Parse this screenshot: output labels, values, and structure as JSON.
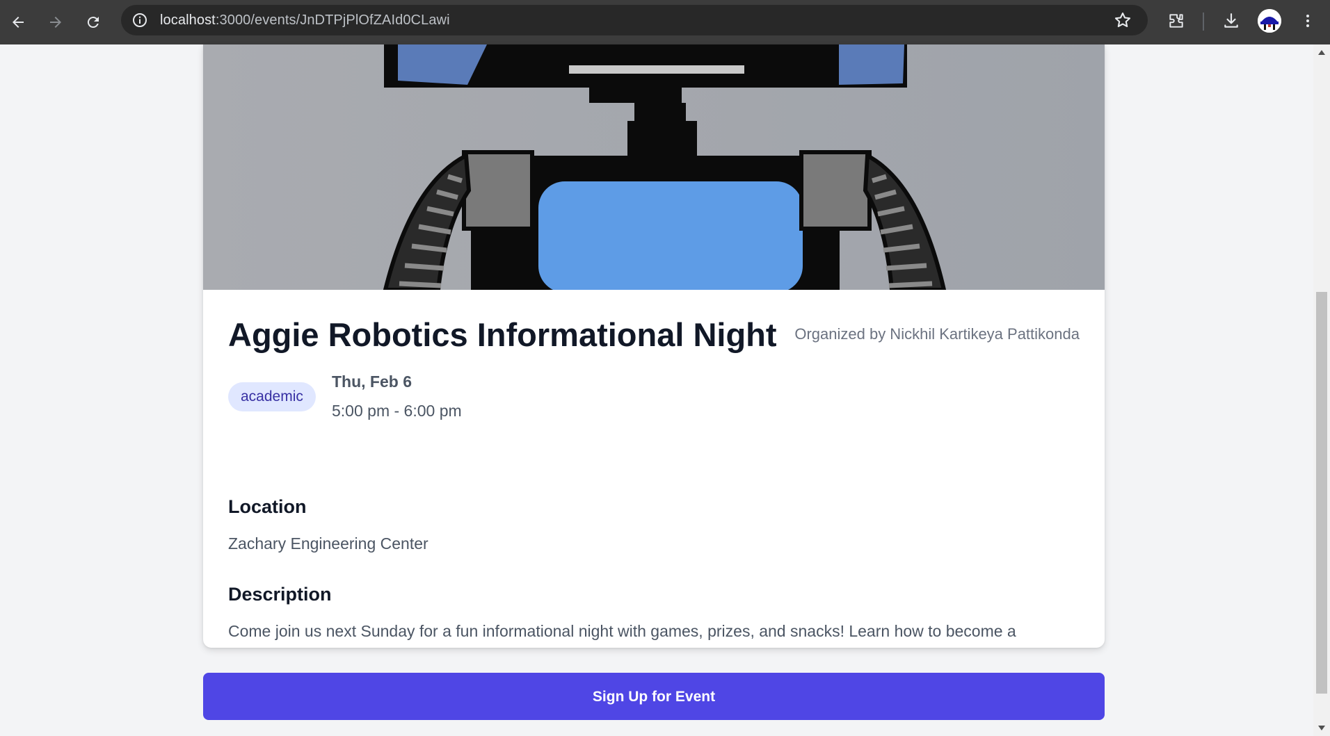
{
  "browser": {
    "url_host": "localhost",
    "url_path": ":3000/events/JnDTPjPlOfZAId0CLawi",
    "icons": [
      "back-icon",
      "forward-icon",
      "reload-icon",
      "site-info-icon",
      "bookmark-star-icon",
      "extensions-icon",
      "download-icon",
      "menu-kebab-icon"
    ]
  },
  "event": {
    "title": "Aggie Robotics Informational Night",
    "organizer": "Organized by Nickhil Kartikeya Pattikonda",
    "category": "academic",
    "date": "Thu, Feb 6",
    "time": "5:00 pm - 6:00 pm",
    "location_heading": "Location",
    "location": "Zachary Engineering Center",
    "description_heading": "Description",
    "description": "Come join us next Sunday for a fun informational night with games, prizes, and snacks! Learn how to become a member and what events we will have this semester."
  },
  "actions": {
    "signup_label": "Sign Up for Event"
  },
  "colors": {
    "accent": "#4f46e5",
    "badge_bg": "#e0e7ff",
    "badge_text": "#3730a3",
    "page_bg": "#f3f4f6"
  }
}
